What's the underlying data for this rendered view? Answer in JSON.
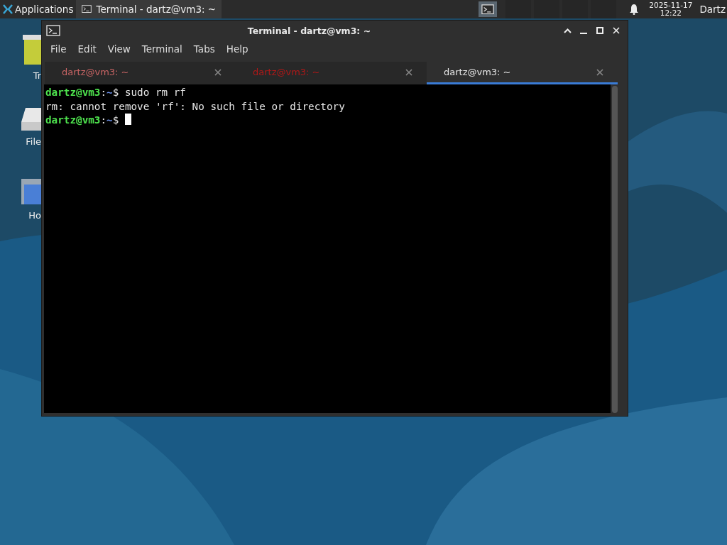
{
  "taskbar": {
    "apps_menu": "Applications",
    "task": {
      "title": "Terminal - dartz@vm3: ~",
      "selected": true
    },
    "date": "2025-11-17",
    "time": "12:22",
    "user": "Dartz"
  },
  "desktop_icons": [
    {
      "kind": "trash",
      "label": "Tr"
    },
    {
      "kind": "drive",
      "label": "File"
    },
    {
      "kind": "home",
      "label": "Ho"
    }
  ],
  "window": {
    "title": "Terminal - dartz@vm3: ~",
    "menu": [
      "File",
      "Edit",
      "View",
      "Terminal",
      "Tabs",
      "Help"
    ],
    "tabs": [
      {
        "label": "dartz@vm3: ~",
        "selected": false,
        "color": "#c86464"
      },
      {
        "label": "dartz@vm3: ~",
        "selected": false,
        "color": "#b01818"
      },
      {
        "label": "dartz@vm3: ~",
        "selected": true,
        "color": "#e6e6e6"
      }
    ],
    "lines": [
      {
        "kind": "prompt",
        "host": "dartz@vm3",
        "sep": ":",
        "path": "~",
        "symbol": "$",
        "command": "sudo rm rf",
        "cursor": false
      },
      {
        "kind": "output",
        "text": "rm: cannot remove 'rf': No such file or directory"
      },
      {
        "kind": "prompt",
        "host": "dartz@vm3",
        "sep": ":",
        "path": "~",
        "symbol": "$",
        "cursor": true
      }
    ]
  }
}
